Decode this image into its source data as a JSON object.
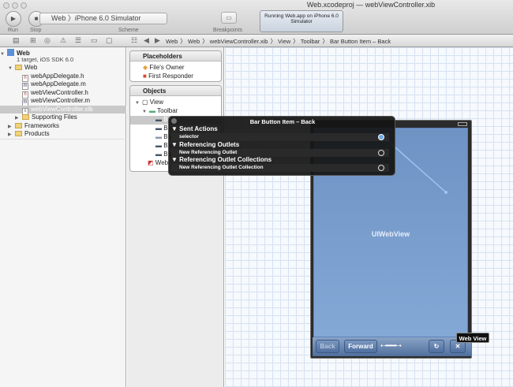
{
  "window": {
    "title_project": "Web.xcodeproj",
    "title_sep": "—",
    "title_file": "webViewController.xib"
  },
  "toolbar": {
    "run": "Run",
    "stop": "Stop",
    "scheme_label": "Scheme",
    "scheme_value": "Web 〉iPhone 6.0 Simulator",
    "breakpoints": "Breakpoints",
    "activity": "Running Web.app on iPhone 6.0 Simulator"
  },
  "jumpbar": {
    "crumbs": [
      "Web",
      "Web",
      "webViewController.xib",
      "View",
      "Toolbar",
      "Bar Button Item – Back"
    ]
  },
  "navigator": {
    "project": "Web",
    "project_sub": "1 target, iOS SDK 6.0",
    "items": [
      {
        "label": "Web",
        "type": "folder"
      },
      {
        "label": "webAppDelegate.h",
        "type": "h"
      },
      {
        "label": "webAppDelegate.m",
        "type": "m"
      },
      {
        "label": "webViewController.h",
        "type": "h"
      },
      {
        "label": "webViewController.m",
        "type": "m"
      },
      {
        "label": "webViewController.xib",
        "type": "xib"
      },
      {
        "label": "Supporting Files",
        "type": "folder"
      },
      {
        "label": "Frameworks",
        "type": "folder"
      },
      {
        "label": "Products",
        "type": "folder"
      }
    ]
  },
  "objects_panel": {
    "placeholders": "Placeholders",
    "files_owner": "File's Owner",
    "first_responder": "First Responder",
    "objects": "Objects",
    "view": "View",
    "toolbar": "Toolbar",
    "bar_items": [
      "Ba",
      "Ba",
      "Ba",
      "Ba",
      "Ba"
    ],
    "web": "Web"
  },
  "popup": {
    "title": "Bar Button Item – Back",
    "sent_actions": "Sent Actions",
    "selector": "selector",
    "referencing_outlets": "Referencing Outlets",
    "new_outlet": "New Referencing Outlet",
    "outlet_collections": "Referencing Outlet Collections",
    "new_collection": "New Referencing Outlet Collection"
  },
  "canvas": {
    "webview_label": "UIWebView",
    "back": "Back",
    "forward": "Forward",
    "refresh": "↻",
    "stop": "✕",
    "tooltip": "Web View"
  }
}
